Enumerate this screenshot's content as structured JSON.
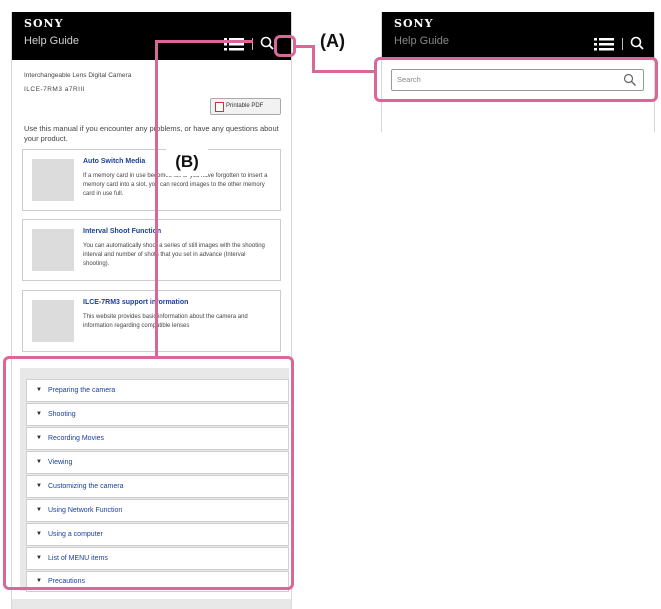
{
  "left_screen": {
    "brand": "SONY",
    "app_title": "Help Guide",
    "model_line1": "Interchangeable Lens Digital Camera",
    "model_line2": "ILCE-7RM3  a7RIII",
    "pdf_button_label": "Printable PDF",
    "intro_text": "Use this manual if you encounter any problems, or have any questions about your product.",
    "cards": [
      {
        "title": "Auto Switch Media",
        "desc": "If a memory card in use becomes full or you have forgotten to insert a memory card into a slot, you can record images to the other memory card in use full."
      },
      {
        "title": "Interval Shoot Function",
        "desc": "You can automatically shoot a series of still images with the shooting interval and number of shots that you set in advance (Interval shooting)."
      },
      {
        "title": "ILCE-7RM3 support information",
        "desc": "This website provides basic information about the camera and information regarding compatible lenses"
      }
    ],
    "menu_items": [
      "Preparing the camera",
      "Shooting",
      "Recording Movies",
      "Viewing",
      "Customizing the camera",
      "Using Network Function",
      "Using a computer",
      "List of MENU items",
      "Precautions"
    ]
  },
  "right_screen": {
    "brand": "SONY",
    "app_title": "Help Guide",
    "search_placeholder": "Search"
  },
  "callouts": {
    "a": "(A)",
    "b": "(B)"
  },
  "colors": {
    "highlight": "#d9679a",
    "link": "#1a3f9a",
    "header_bg": "#000000"
  },
  "icons": [
    "menu-icon",
    "search-icon",
    "pdf-icon",
    "triangle-down-icon"
  ]
}
